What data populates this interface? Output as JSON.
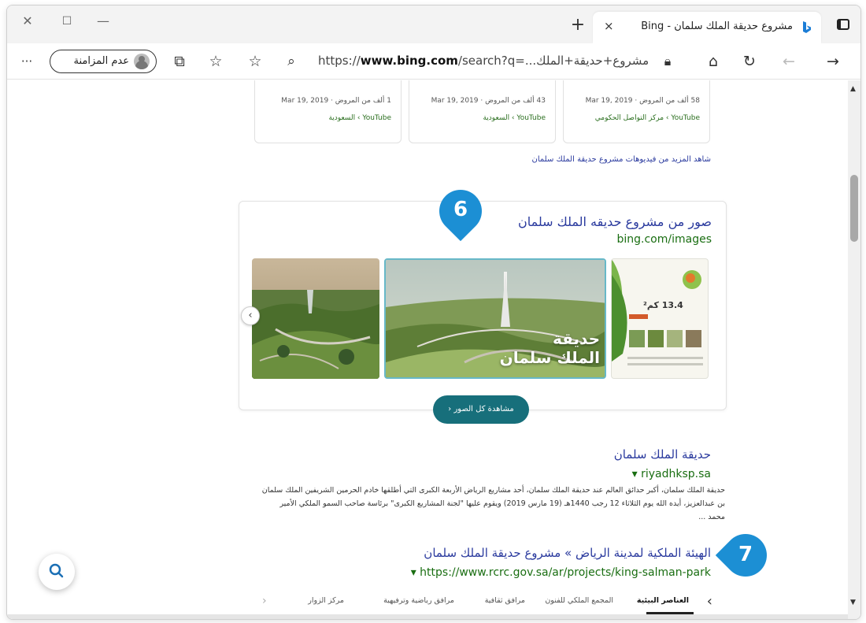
{
  "tabbar": {
    "tab_title": "مشروع حديقة الملك سلمان - Bing",
    "new_tab": "+",
    "close": "×"
  },
  "toolbar": {
    "profile_label": "عدم المزامنة",
    "url_prefix": "https://",
    "url_domain": "www.bing.com",
    "url_rest": "/search?q=...مشروع+حديقة+الملك",
    "more": "···"
  },
  "videos": [
    {
      "meta": "58 ألف من المروض · Mar 19, 2019",
      "source": "YouTube › مركز التواصل الحكومي"
    },
    {
      "meta": "43 ألف من المروض · Mar 19, 2019",
      "source": "YouTube › السعودية"
    },
    {
      "meta": "1 ألف من المروض · Mar 19, 2019",
      "source": "YouTube › السعودية"
    }
  ],
  "more_videos": "شاهد المزيد من فيديوهات مشروع حديقة الملك سلمان",
  "images_panel": {
    "title": "صور من مشروع حديقه الملك سلمان",
    "url": "bing.com/images",
    "overlay_text_line1": "حديقة",
    "overlay_text_line2": "الملك سلمان",
    "poster_area": "13.4 كم²",
    "see_all": "مشاهدة كل الصور"
  },
  "markers": {
    "m6": "6",
    "m7": "7"
  },
  "result1": {
    "title": "حديقة الملك سلمان",
    "url": "riyadhksp.sa",
    "snippet_line1": "حديقة الملك سلمان، أكبر حدائق العالم عند حديقة الملك سلمان، أحد مشاريع الرياض الأربعة الكبرى التي أطلقها خادم الحرمين الشريفين الملك سلمان",
    "snippet_line2": "بن عبدالعزيز، أيده الله يوم الثلاثاء 12 رجب 1440هـ (19 مارس 2019) ويقوم عليها \"لجنة المشاريع الكبرى\" برئاسة صاحب السمو الملكي الأمير",
    "snippet_line3": "محمد ..."
  },
  "result2": {
    "title": "الهيئة الملكية لمدينة الرياض » مشروع حديقة الملك سلمان",
    "url": "https://www.rcrc.gov.sa/ar/projects/king-salman-park"
  },
  "bottom_tabs": [
    "العناصر البيئية",
    "المجمع الملكي للفنون",
    "مرافق ثقافية",
    "مرافق رياضية وترفيهية",
    "مركز الزوار"
  ]
}
